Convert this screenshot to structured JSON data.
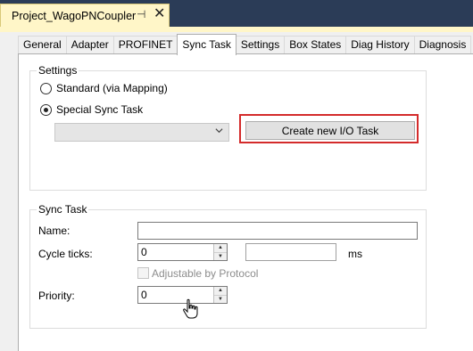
{
  "document_tab": {
    "title": "Project_WagoPNCoupler",
    "pin_glyph": "⊣",
    "close_glyph": "✕"
  },
  "tabs": [
    {
      "label": "General",
      "active": false
    },
    {
      "label": "Adapter",
      "active": false
    },
    {
      "label": "PROFINET",
      "active": false
    },
    {
      "label": "Sync Task",
      "active": true
    },
    {
      "label": "Settings",
      "active": false
    },
    {
      "label": "Box States",
      "active": false
    },
    {
      "label": "Diag History",
      "active": false
    },
    {
      "label": "Diagnosis",
      "active": false
    }
  ],
  "settings": {
    "group_title": "Settings",
    "radio_standard_label": "Standard (via Mapping)",
    "radio_special_label": "Special Sync Task",
    "selected_option": "Special Sync Task",
    "task_select_value": "",
    "create_task_button": "Create new I/O Task"
  },
  "sync_task": {
    "group_title": "Sync Task",
    "name_label": "Name:",
    "name_value": "",
    "cycle_ticks_label": "Cycle ticks:",
    "cycle_ticks_value": "0",
    "cycle_time_value": "",
    "ms_label": "ms",
    "adjustable_label": "Adjustable by Protocol",
    "adjustable_checked": false,
    "priority_label": "Priority:",
    "priority_value": "0"
  },
  "colors": {
    "highlight": "#d42b2b",
    "doc_tab": "#fff6c8",
    "background": "#2b3c57"
  },
  "icons": [
    "pin-icon",
    "close-icon",
    "chevron-down-icon",
    "hand-cursor-icon"
  ]
}
